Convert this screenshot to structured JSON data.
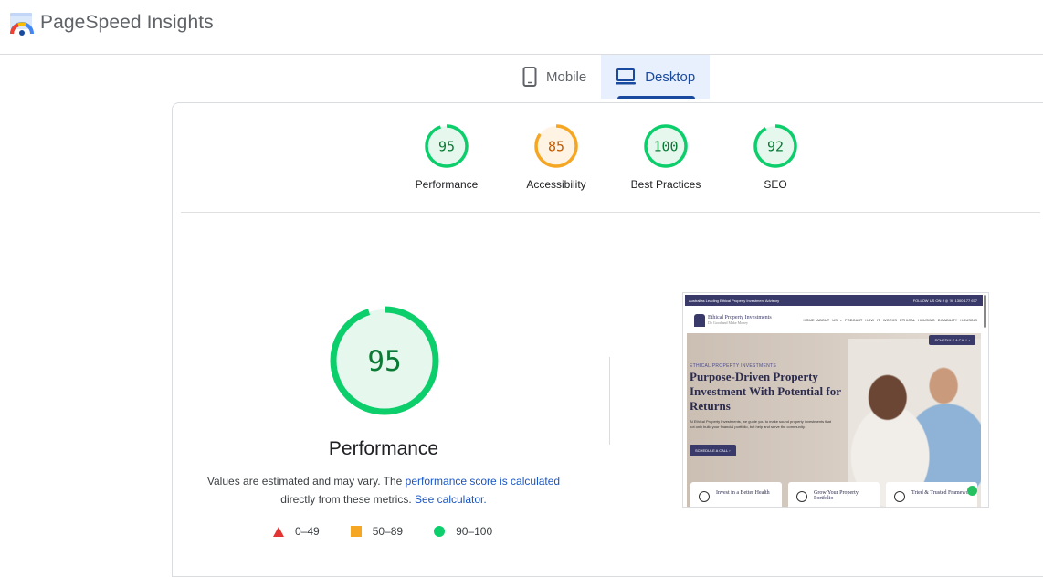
{
  "app": {
    "title": "PageSpeed Insights"
  },
  "tabs": [
    {
      "label": "Mobile",
      "icon": "phone-icon",
      "active": false
    },
    {
      "label": "Desktop",
      "icon": "laptop-icon",
      "active": true
    }
  ],
  "scores": [
    {
      "label": "Performance",
      "value": "95",
      "status": "good"
    },
    {
      "label": "Accessibility",
      "value": "85",
      "status": "average"
    },
    {
      "label": "Best Practices",
      "value": "100",
      "status": "good"
    },
    {
      "label": "SEO",
      "value": "92",
      "status": "good"
    }
  ],
  "main_gauge": {
    "value": "95",
    "label": "Performance",
    "fraction": 0.95
  },
  "note": {
    "text_before": "Values are estimated and may vary. The ",
    "link1": "performance score is calculated",
    "text_middle": " directly from these metrics. ",
    "link2": "See calculator.",
    "text_after": ""
  },
  "legend": [
    {
      "label": "0–49",
      "shape": "triangle",
      "color": "#e33434"
    },
    {
      "label": "50–89",
      "shape": "square",
      "color": "#f5a623"
    },
    {
      "label": "90–100",
      "shape": "circle",
      "color": "#0cce6b"
    }
  ],
  "colors": {
    "good": "#0cce6b",
    "good_text": "#0a7a34",
    "good_fill": "#e6f8ee",
    "average": "#f5a623",
    "average_text": "#c25a00",
    "average_fill": "#fff3e3",
    "accent": "#1a4a9e"
  },
  "screenshot": {
    "topbar_left": "Australias Leading Ethical Property Investment Advisory",
    "topbar_right": "FOLLOW US ON:  f  ◎   ☏ 1300 177 677",
    "brand": "Ethical Property Investments",
    "brand_tagline": "Do Good and Make Money",
    "nav": "HOME  ABOUT US ▾  PODCAST  HOW IT WORKS  ETHICAL HOUSING  DISABILITY HOUSING",
    "call_button": "SCHEDULE A CALL ›",
    "kicker": "ETHICAL PROPERTY INVESTMENTS",
    "headline": "Purpose-Driven Property Investment With Potential for Returns",
    "paragraph": "At Ethical Property Investments, we guide you to make sound property investments that not only build your financial portfolio, but help and serve the community.",
    "cta": "SCHEDULE A CALL ›",
    "features": [
      "Invest in a Better Health",
      "Grow Your Property Portfolio",
      "Tried & Trusted Framework"
    ]
  }
}
